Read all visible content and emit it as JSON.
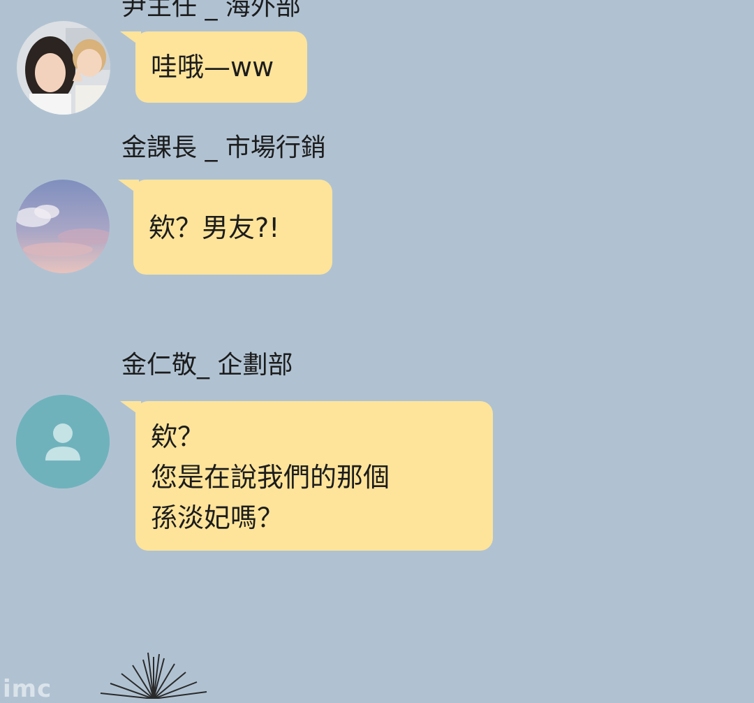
{
  "messages": [
    {
      "sender": "尹主任 _ 海外部",
      "avatar": "photo-two-friends-avatar",
      "lines": [
        "哇哦—ww"
      ]
    },
    {
      "sender": "金課長 _ 市場行銷",
      "avatar": "sky-clouds-avatar",
      "lines": [
        "欸？男友?!"
      ]
    },
    {
      "sender": "金仁敬_ 企劃部",
      "avatar": "default-person-avatar",
      "lines": [
        "欸？",
        "您是在說我們的那個",
        "孫淡妃嗎？"
      ]
    }
  ],
  "colors": {
    "background": "#b0c2d2",
    "bubble": "#fde49a",
    "default_avatar": "#6fb2bc"
  },
  "watermark": "imc"
}
